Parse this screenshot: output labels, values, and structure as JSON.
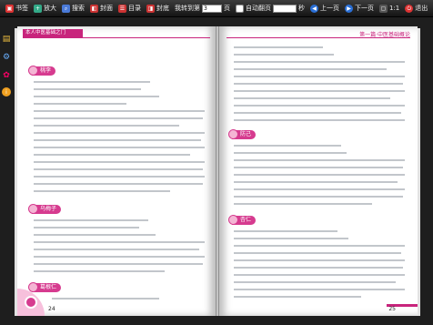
{
  "toolbar": {
    "bookmark": "书签",
    "zoom_in": "放大",
    "search": "搜索",
    "back_cover": "封面",
    "contents": "目录",
    "front_cover": "封底",
    "goto_label": "我转到第",
    "goto_value": "3",
    "goto_suffix": "页",
    "autoflip_label": "自动翻页",
    "seconds": "秒",
    "prev": "上一页",
    "next": "下一页",
    "ratio": "1:1",
    "exit": "退出"
  },
  "left_page": {
    "header": "本人中医基础之门",
    "page_number": "24",
    "sections": [
      "桃李",
      "乌梅子",
      "葛根仁"
    ]
  },
  "right_page": {
    "header": "第一篇·中医基础概论",
    "page_number": "25",
    "sections": [
      "防己",
      "杏仁"
    ]
  }
}
